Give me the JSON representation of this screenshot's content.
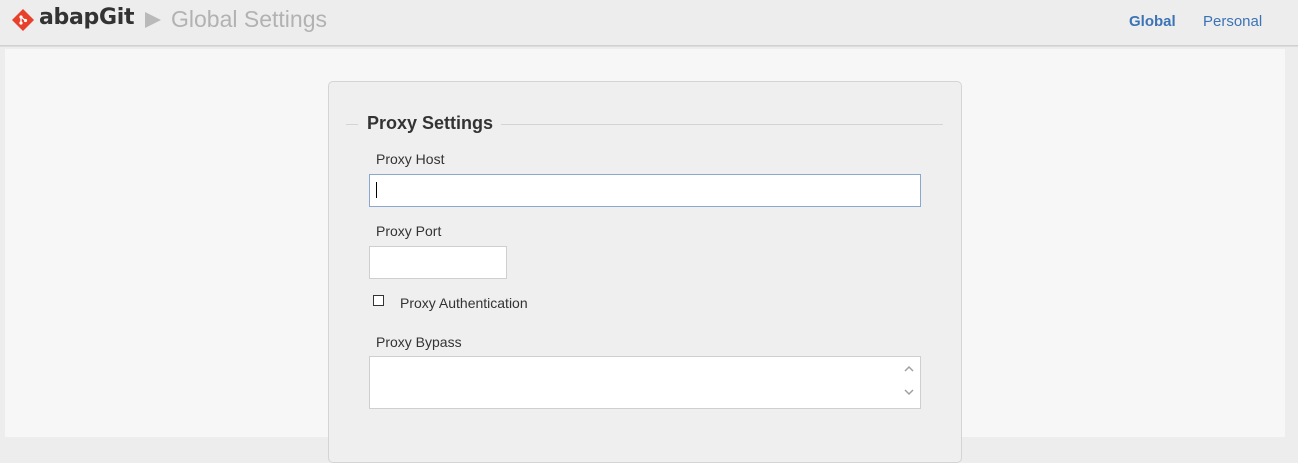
{
  "header": {
    "brand": "abapGit",
    "page_title": "Global Settings",
    "nav": {
      "global_label": "Global",
      "personal_label": "Personal"
    },
    "logo_icon": "git-diamond-icon",
    "separator_icon": "triangle-right-icon"
  },
  "form": {
    "legend": "Proxy Settings",
    "proxy_host": {
      "label": "Proxy Host",
      "value": ""
    },
    "proxy_port": {
      "label": "Proxy Port",
      "value": ""
    },
    "proxy_auth": {
      "label": "Proxy Authentication",
      "checked": false
    },
    "proxy_bypass": {
      "label": "Proxy Bypass",
      "value": ""
    }
  },
  "colors": {
    "link": "#3b74b5",
    "logo": "#e8412b"
  }
}
